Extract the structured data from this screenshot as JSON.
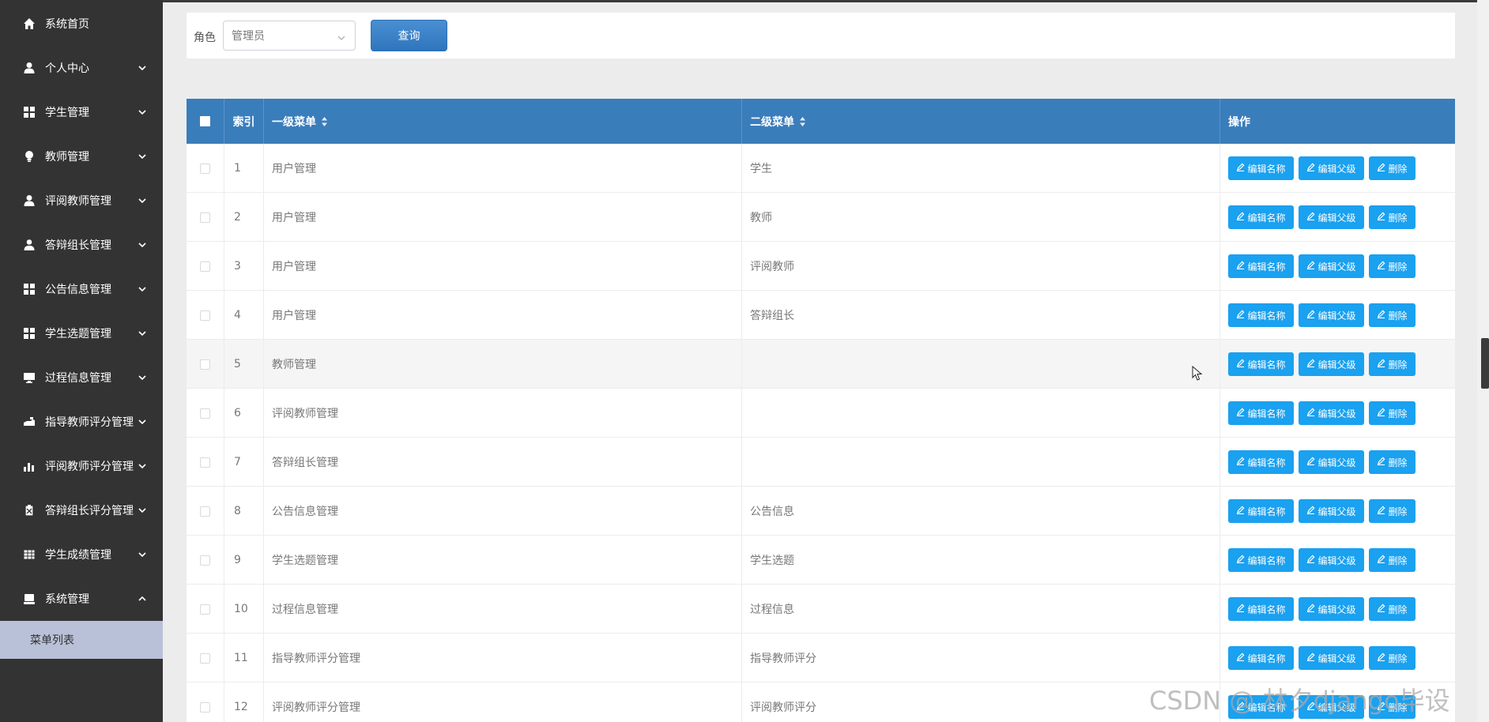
{
  "sidebar": {
    "items": [
      {
        "label": "系统首页",
        "icon": "home-icon",
        "has_chevron": false
      },
      {
        "label": "个人中心",
        "icon": "user-icon",
        "has_chevron": true
      },
      {
        "label": "学生管理",
        "icon": "grid-icon",
        "has_chevron": true
      },
      {
        "label": "教师管理",
        "icon": "bulb-icon",
        "has_chevron": true
      },
      {
        "label": "评阅教师管理",
        "icon": "user-icon",
        "has_chevron": true
      },
      {
        "label": "答辩组长管理",
        "icon": "user-tie-icon",
        "has_chevron": true
      },
      {
        "label": "公告信息管理",
        "icon": "grid-icon",
        "has_chevron": true
      },
      {
        "label": "学生选题管理",
        "icon": "grid-icon",
        "has_chevron": true
      },
      {
        "label": "过程信息管理",
        "icon": "monitor-icon",
        "has_chevron": true
      },
      {
        "label": "指导教师评分管理",
        "icon": "hand-icon",
        "has_chevron": true
      },
      {
        "label": "评阅教师评分管理",
        "icon": "bar-chart-icon",
        "has_chevron": true
      },
      {
        "label": "答辩组长评分管理",
        "icon": "clipboard-icon",
        "has_chevron": true
      },
      {
        "label": "学生成绩管理",
        "icon": "table-icon",
        "has_chevron": true
      },
      {
        "label": "系统管理",
        "icon": "drive-icon",
        "has_chevron": true,
        "expanded": true
      }
    ],
    "submenu": {
      "label": "菜单列表"
    }
  },
  "search": {
    "role_label": "角色",
    "role_value": "管理员",
    "query_label": "查询"
  },
  "table": {
    "headers": {
      "index": "索引",
      "level1": "一级菜单",
      "level2": "二级菜单",
      "actions": "操作"
    },
    "action_labels": {
      "edit_name": "编辑名称",
      "edit_parent": "编辑父级",
      "delete": "删除"
    },
    "rows": [
      {
        "index": "1",
        "level1": "用户管理",
        "level2": "学生"
      },
      {
        "index": "2",
        "level1": "用户管理",
        "level2": "教师"
      },
      {
        "index": "3",
        "level1": "用户管理",
        "level2": "评阅教师"
      },
      {
        "index": "4",
        "level1": "用户管理",
        "level2": "答辩组长"
      },
      {
        "index": "5",
        "level1": "教师管理",
        "level2": ""
      },
      {
        "index": "6",
        "level1": "评阅教师管理",
        "level2": ""
      },
      {
        "index": "7",
        "level1": "答辩组长管理",
        "level2": ""
      },
      {
        "index": "8",
        "level1": "公告信息管理",
        "level2": "公告信息"
      },
      {
        "index": "9",
        "level1": "学生选题管理",
        "level2": "学生选题"
      },
      {
        "index": "10",
        "level1": "过程信息管理",
        "level2": "过程信息"
      },
      {
        "index": "11",
        "level1": "指导教师评分管理",
        "level2": "指导教师评分"
      },
      {
        "index": "12",
        "level1": "评阅教师评分管理",
        "level2": "评阅教师评分"
      }
    ]
  },
  "watermark": "CSDN @ 林夕django毕设",
  "colors": {
    "sidebar_bg": "#333333",
    "table_header": "#3a7dbb",
    "action_button": "#1aa1f0",
    "submenu_active": "#b9c1d8"
  }
}
